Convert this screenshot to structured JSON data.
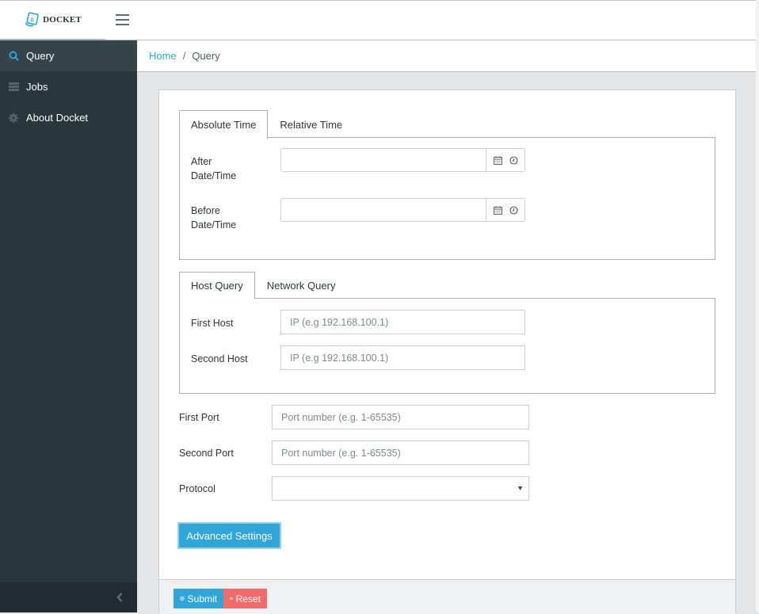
{
  "app": {
    "brand_name": "DOCKET",
    "logo_icon": "docket-logo-icon",
    "menu_icon": "hamburger-icon"
  },
  "sidebar": {
    "items": [
      {
        "label": "Query",
        "icon": "search-icon",
        "active": true
      },
      {
        "label": "Jobs",
        "icon": "server-icon",
        "active": false
      },
      {
        "label": "About Docket",
        "icon": "gear-icon",
        "active": false
      }
    ],
    "collapse_icon": "chevron-left-icon"
  },
  "breadcrumb": {
    "home": "Home",
    "separator": "/",
    "current": "Query"
  },
  "time_tabs": {
    "tabs": [
      {
        "label": "Absolute Time",
        "active": true
      },
      {
        "label": "Relative Time",
        "active": false
      }
    ],
    "fields": [
      {
        "label_line1": "After",
        "label_line2": "Date/Time",
        "value": ""
      },
      {
        "label_line1": "Before",
        "label_line2": "Date/Time",
        "value": ""
      }
    ]
  },
  "query_tabs": {
    "tabs": [
      {
        "label": "Host Query",
        "active": true
      },
      {
        "label": "Network Query",
        "active": false
      }
    ],
    "fields": [
      {
        "label": "First Host",
        "placeholder": "IP (e.g 192.168.100.1)",
        "value": ""
      },
      {
        "label": "Second Host",
        "placeholder": "IP (e.g 192.168.100.1)",
        "value": ""
      }
    ]
  },
  "ports": [
    {
      "label": "First Port",
      "placeholder": "Port number (e.g. 1-65535)",
      "value": ""
    },
    {
      "label": "Second Port",
      "placeholder": "Port number (e.g. 1-65535)",
      "value": ""
    }
  ],
  "protocol": {
    "label": "Protocol",
    "selected": ""
  },
  "buttons": {
    "advanced": "Advanced Settings",
    "submit": "Submit",
    "reset": "Reset"
  },
  "colors": {
    "accent": "#2fa6d8",
    "danger": "#f26b69",
    "sidebar_bg": "#2a363e",
    "sidebar_active": "#36444c"
  }
}
